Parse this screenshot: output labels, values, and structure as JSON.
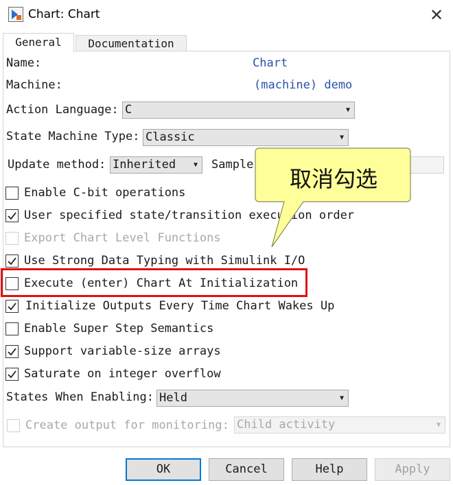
{
  "window": {
    "title": "Chart: Chart",
    "close_glyph": "✕",
    "icon": "chart-app-icon"
  },
  "tabs": [
    {
      "label": "General",
      "selected": true
    },
    {
      "label": "Documentation",
      "selected": false
    }
  ],
  "fields": {
    "name_label": "Name:",
    "name_value": "Chart",
    "machine_label": "Machine:",
    "machine_value": "(machine) demo",
    "action_language_label": "Action Language:",
    "action_language_value": "C",
    "state_machine_type_label": "State Machine Type:",
    "state_machine_type_value": "Classic",
    "update_method_label": "Update method:",
    "update_method_value": "Inherited",
    "sample_label": "Sample",
    "states_when_enabling_label": "States When Enabling:",
    "states_when_enabling_value": "Held",
    "create_output_label": "Create output for monitoring:",
    "create_output_value": "Child activity"
  },
  "checkboxes": [
    {
      "label": "Enable C-bit operations",
      "checked": false,
      "enabled": true
    },
    {
      "label": "User specified state/transition execution order",
      "checked": true,
      "enabled": true
    },
    {
      "label": "Export Chart Level Functions",
      "checked": false,
      "enabled": false
    },
    {
      "label": "Use Strong Data Typing with Simulink I/O",
      "checked": true,
      "enabled": true
    },
    {
      "label": "Execute (enter) Chart At Initialization",
      "checked": false,
      "enabled": true
    },
    {
      "label": "Initialize Outputs Every Time Chart Wakes Up",
      "checked": true,
      "enabled": true
    },
    {
      "label": "Enable Super Step Semantics",
      "checked": false,
      "enabled": true
    },
    {
      "label": "Support variable-size arrays",
      "checked": true,
      "enabled": true
    },
    {
      "label": "Saturate on integer overflow",
      "checked": true,
      "enabled": true
    },
    {
      "label": "Create output for monitoring:",
      "checked": false,
      "enabled": false
    }
  ],
  "buttons": {
    "ok": "OK",
    "cancel": "Cancel",
    "help": "Help",
    "apply": "Apply"
  },
  "annotation": {
    "callout_text": "取消勾选",
    "callout_color": "#ffff99",
    "highlight_color": "#e01010"
  },
  "colors": {
    "value_blue": "#2a52a8",
    "ok_border": "#0078d7"
  }
}
